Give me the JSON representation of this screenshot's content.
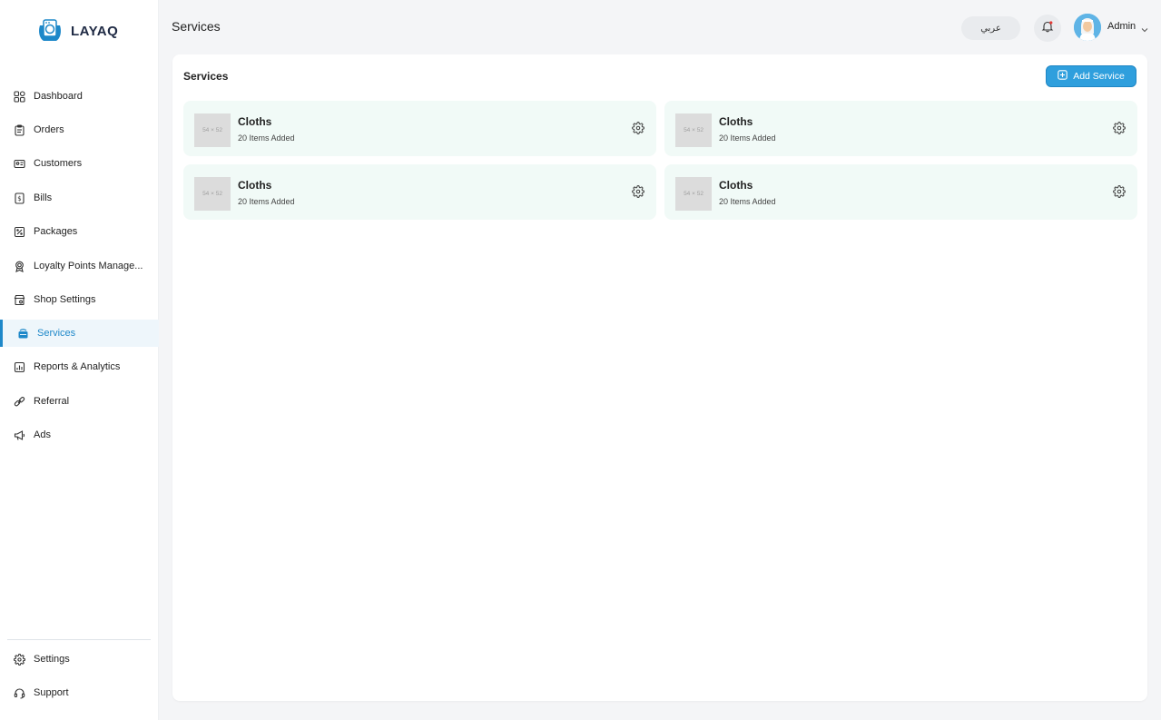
{
  "brand": {
    "name": "LAYAQ",
    "accent": "#1e88c9"
  },
  "sidebar": {
    "items": [
      {
        "label": "Dashboard",
        "icon": "grid-icon"
      },
      {
        "label": "Orders",
        "icon": "clipboard-icon"
      },
      {
        "label": "Customers",
        "icon": "id-card-icon"
      },
      {
        "label": "Bills",
        "icon": "dollar-icon"
      },
      {
        "label": "Packages",
        "icon": "percent-box-icon"
      },
      {
        "label": "Loyalty Points Manage...",
        "icon": "badge-icon"
      },
      {
        "label": "Shop Settings",
        "icon": "store-icon"
      },
      {
        "label": "Services",
        "icon": "basket-icon",
        "active": true
      },
      {
        "label": "Reports & Analytics",
        "icon": "chart-icon"
      },
      {
        "label": "Referral",
        "icon": "link-icon"
      },
      {
        "label": "Ads",
        "icon": "megaphone-icon"
      }
    ],
    "bottom": [
      {
        "label": "Settings",
        "icon": "gear-icon"
      },
      {
        "label": "Support",
        "icon": "headset-icon"
      }
    ]
  },
  "header": {
    "title": "Services",
    "language_label": "عربي",
    "user_name": "Admin"
  },
  "main": {
    "title": "Services",
    "add_button_label": "Add Service",
    "cards": [
      {
        "name": "Cloths",
        "count": "20 Items Added",
        "thumb": "54 × 52"
      },
      {
        "name": "Cloths",
        "count": "20 Items Added",
        "thumb": "54 × 52"
      },
      {
        "name": "Cloths",
        "count": "20 Items Added",
        "thumb": "54 × 52"
      },
      {
        "name": "Cloths",
        "count": "20 Items Added",
        "thumb": "54 × 52"
      }
    ]
  }
}
